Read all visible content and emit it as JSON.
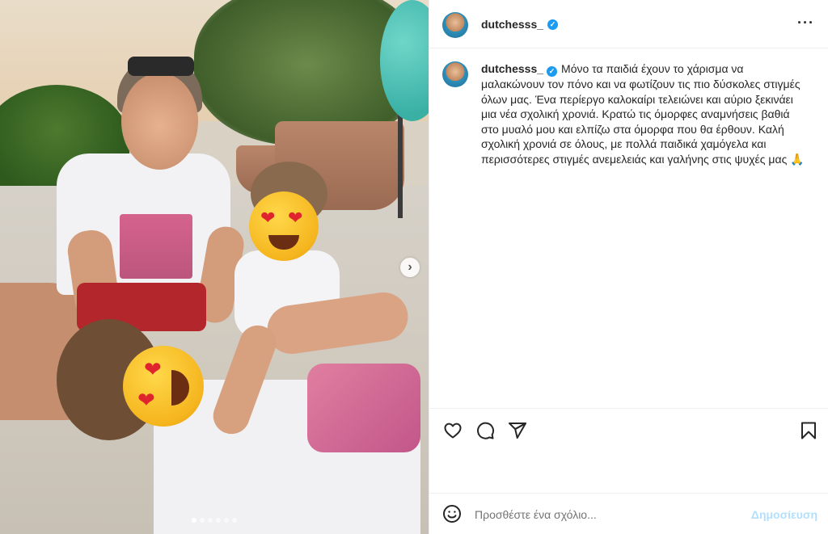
{
  "post": {
    "username": "dutchesss_",
    "verified": true,
    "caption": "Μόνο τα παιδιά έχουν το χάρισμα να μαλακώνουν τον πόνο και να φωτίζουν τις πιο δύσκολες στιγμές όλων μας. Ένα περίεργο καλοκαίρι τελειώνει και αύριο ξεκινάει μια νέα σχολική χρονιά. Κρατώ τις όμορφες αναμνήσεις βαθιά στο μυαλό μου και ελπίζω στα όμορφα που θα έρθουν. Καλή σχολική χρονιά σε όλους, με πολλά παιδικά χαμόγελα και περισσότερες στιγμές ανεμελειάς και γαλήνης στις ψυχές μας 🙏"
  },
  "media": {
    "slide_count": 6,
    "active_slide": 1
  },
  "comment_box": {
    "placeholder": "Προσθέστε ένα σχόλιο...",
    "post_label": "Δημοσίευση"
  },
  "icons": {
    "more": "more-options-icon",
    "like": "heart-icon",
    "comment": "comment-icon",
    "share": "share-icon",
    "save": "bookmark-icon",
    "emoji": "emoji-icon",
    "next": "chevron-right-icon",
    "verified": "verified-badge-icon"
  },
  "colors": {
    "verified": "#1d9bf0",
    "post_button_disabled": "#b2dffc",
    "border": "#efefef"
  }
}
